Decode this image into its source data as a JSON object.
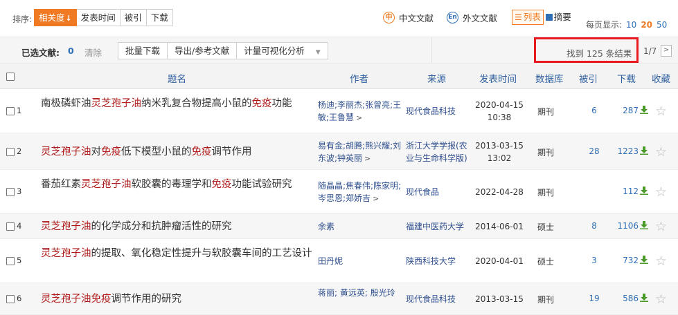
{
  "sort": {
    "label": "排序:",
    "options": [
      {
        "label": "相关度",
        "arrow": "↓",
        "active": true
      },
      {
        "label": "发表时间",
        "active": false
      },
      {
        "label": "被引",
        "active": false
      },
      {
        "label": "下载",
        "active": false
      }
    ]
  },
  "lang": {
    "chinese": {
      "icon": "中",
      "label": "中文文献"
    },
    "foreign": {
      "icon": "En",
      "label": "外文文献"
    }
  },
  "view": {
    "list": {
      "icon": "☰",
      "label": "列表"
    },
    "abstract": {
      "label": "摘要"
    }
  },
  "perpage": {
    "label": "每页显示:",
    "options": [
      "10",
      "20",
      "50"
    ],
    "current": "20"
  },
  "actions": {
    "selected_label": "已选文献:",
    "selected_count": "0",
    "clear": "清除",
    "batch_download": "批量下载",
    "export": "导出/参考文献",
    "visual": "计量可视化分析",
    "visual_caret": "▼"
  },
  "result": {
    "text": "找到 125 条结果",
    "pager": "1/7",
    "next": ">"
  },
  "columns": {
    "title": "题名",
    "author": "作者",
    "source": "来源",
    "date": "发表时间",
    "db": "数据库",
    "cite": "被引",
    "download": "下载",
    "favorite": "收藏"
  },
  "rows": [
    {
      "num": "1",
      "title_parts": [
        {
          "t": "南极磷虾油",
          "hl": false
        },
        {
          "t": "灵芝孢子油",
          "hl": true
        },
        {
          "t": "纳米乳复合物提高小鼠的",
          "hl": false
        },
        {
          "t": "免疫",
          "hl": true
        },
        {
          "t": "功能",
          "hl": false
        }
      ],
      "authors": "杨迪;李丽杰;张曾亮;王敏;王鲁慧",
      "authors_more": ">",
      "source": "现代食品科技",
      "date": "2020-04-15",
      "time": "10:38",
      "db": "期刊",
      "cite": "6",
      "download": "287"
    },
    {
      "num": "2",
      "title_parts": [
        {
          "t": "灵芝孢子油",
          "hl": true
        },
        {
          "t": "对",
          "hl": false
        },
        {
          "t": "免疫",
          "hl": true
        },
        {
          "t": "低下模型小鼠的",
          "hl": false
        },
        {
          "t": "免疫",
          "hl": true
        },
        {
          "t": "调节作用",
          "hl": false
        }
      ],
      "authors": "易有金;胡腾;熊兴耀;刘东波;钟英丽",
      "authors_more": ">",
      "source": "浙江大学学报(农业与生命科学版)",
      "date": "2013-03-15",
      "time": "13:02",
      "db": "期刊",
      "cite": "28",
      "download": "1223"
    },
    {
      "num": "3",
      "title_parts": [
        {
          "t": "番茄红素",
          "hl": false
        },
        {
          "t": "灵芝孢子油",
          "hl": true
        },
        {
          "t": "软胶囊的毒理学和",
          "hl": false
        },
        {
          "t": "免疫",
          "hl": true
        },
        {
          "t": "功能试验研究",
          "hl": false
        }
      ],
      "authors": "随晶晶;焦春伟;陈家明;岑思恩;郑娇吉",
      "authors_more": ">",
      "source": "现代食品",
      "date": "2022-04-28",
      "time": "",
      "db": "期刊",
      "cite": "",
      "download": "112"
    },
    {
      "num": "4",
      "title_parts": [
        {
          "t": "灵芝孢子油",
          "hl": true
        },
        {
          "t": "的化学成分和抗肿瘤活性的研究",
          "hl": false
        }
      ],
      "authors": "余素",
      "authors_more": "",
      "source": "福建中医药大学",
      "date": "2014-06-01",
      "time": "",
      "db": "硕士",
      "cite": "8",
      "download": "1106"
    },
    {
      "num": "5",
      "title_parts": [
        {
          "t": "灵芝孢子油",
          "hl": true
        },
        {
          "t": "的提取、氧化稳定性提升与软胶囊车间的工艺设计",
          "hl": false
        }
      ],
      "authors": "田丹妮",
      "authors_more": "",
      "source": "陕西科技大学",
      "date": "2020-04-01",
      "time": "",
      "db": "硕士",
      "cite": "3",
      "download": "732"
    },
    {
      "num": "6",
      "title_parts": [
        {
          "t": "灵芝孢子油",
          "hl": true
        },
        {
          "t": "免疫",
          "hl": true
        },
        {
          "t": "调节作用的研究",
          "hl": false
        }
      ],
      "authors": "蒋丽; 黄远英; 殷光玲",
      "authors_more": "",
      "source": "现代食品科技",
      "date": "2013-03-15",
      "time": "",
      "db": "期刊",
      "cite": "19",
      "download": "586"
    }
  ],
  "icons": {
    "download": "download-arrow-icon",
    "favorite": "star-icon"
  },
  "colors": {
    "accent": "#f07a23",
    "highlight": "#b01c1c",
    "link": "#2f4f8e",
    "result_box": "#e8181e"
  }
}
